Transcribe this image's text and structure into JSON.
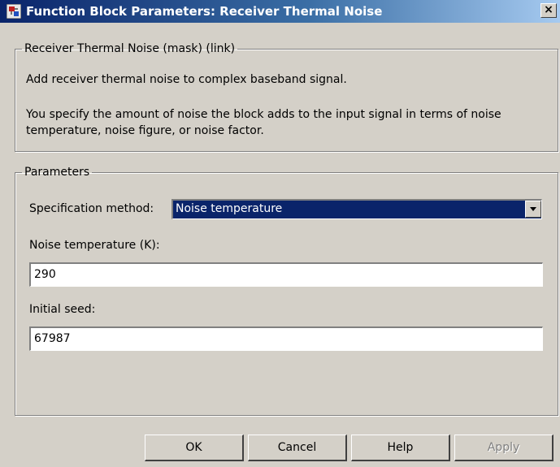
{
  "window": {
    "title": "Function Block Parameters: Receiver Thermal Noise",
    "close_label": "×"
  },
  "description_group": {
    "legend": "Receiver Thermal Noise (mask) (link)",
    "line1": "Add receiver thermal noise to complex baseband signal.",
    "line2a": "You specify the amount of noise the block adds to the input signal in terms of noise",
    "line2b": "temperature, noise figure, or noise factor."
  },
  "parameters_group": {
    "legend": "Parameters",
    "spec_method": {
      "label": "Specification method:",
      "value": "Noise temperature"
    },
    "noise_temperature": {
      "label": "Noise temperature (K):",
      "value": "290"
    },
    "initial_seed": {
      "label": "Initial seed:",
      "value": "67987"
    }
  },
  "buttons": {
    "ok": "OK",
    "cancel": "Cancel",
    "help": "Help",
    "apply": "Apply"
  },
  "icons": {
    "app_icon": "simulink-block-icon",
    "dropdown": "chevron-down-icon"
  }
}
